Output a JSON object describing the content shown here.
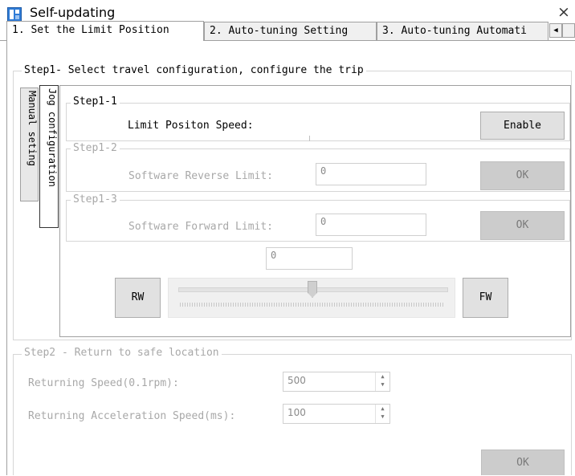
{
  "window": {
    "title": "Self-updating",
    "close_glyph": "×",
    "icon": "app-icon"
  },
  "tabs": [
    {
      "label": "1. Set the Limit Position",
      "active": true
    },
    {
      "label": "2. Auto-tuning Setting",
      "active": false
    },
    {
      "label": "3. Auto-tuning Automati",
      "active": false
    }
  ],
  "tab_scroll_left": "◀",
  "step1": {
    "legend": "Step1- Select travel configuration, configure the trip",
    "side_tabs": [
      {
        "label": "Manual seting",
        "active": false
      },
      {
        "label": "Jog configuration",
        "active": true
      }
    ],
    "step1_1": {
      "legend": "Step1-1",
      "label": "Limit Positon Speed:",
      "button": "Enable"
    },
    "step1_2": {
      "legend": "Step1-2",
      "label": "Software Reverse Limit:",
      "value": "0",
      "button": "OK"
    },
    "step1_3": {
      "legend": "Step1-3",
      "label": "Software Forward Limit:",
      "value": "0",
      "button": "OK"
    },
    "jog": {
      "value": "0",
      "rw_label": "RW",
      "fw_label": "FW",
      "slider_level": 0.5
    }
  },
  "step2": {
    "legend": "Step2 - Return to safe location",
    "returning_speed_label": "Returning Speed(0.1rpm):",
    "returning_speed_value": "500",
    "returning_accel_label": "Returning Acceleration Speed(ms):",
    "returning_accel_value": "100",
    "ok_label": "OK"
  }
}
